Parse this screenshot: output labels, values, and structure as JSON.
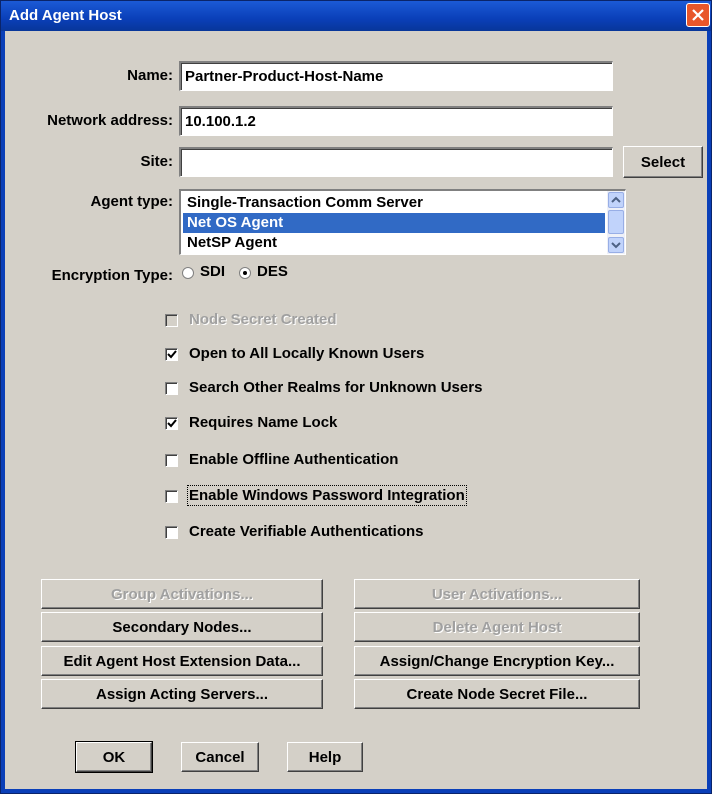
{
  "window": {
    "title": "Add Agent Host"
  },
  "fields": {
    "name_label": "Name:",
    "name_value": "Partner-Product-Host-Name",
    "address_label": "Network address:",
    "address_value": "10.100.1.2",
    "site_label": "Site:",
    "site_value": "",
    "select_button": "Select",
    "agent_type_label": "Agent type:"
  },
  "agent_types": [
    {
      "label": "Single-Transaction Comm Server",
      "selected": false
    },
    {
      "label": "Net OS Agent",
      "selected": true
    },
    {
      "label": "NetSP Agent",
      "selected": false
    }
  ],
  "encryption": {
    "label": "Encryption Type:",
    "options": [
      {
        "label": "SDI",
        "checked": false
      },
      {
        "label": "DES",
        "checked": true
      }
    ]
  },
  "checkboxes": [
    {
      "label": "Node Secret Created",
      "checked": false,
      "disabled": true
    },
    {
      "label": "Open to All Locally Known Users",
      "checked": true,
      "disabled": false
    },
    {
      "label": "Search Other Realms for Unknown Users",
      "checked": false,
      "disabled": false
    },
    {
      "label": "Requires Name Lock",
      "checked": true,
      "disabled": false
    },
    {
      "label": "Enable Offline Authentication",
      "checked": false,
      "disabled": false
    },
    {
      "label": "Enable Windows Password Integration",
      "checked": false,
      "disabled": false
    },
    {
      "label": "Create Verifiable Authentications",
      "checked": false,
      "disabled": false
    }
  ],
  "action_buttons": {
    "group_activations": "Group Activations...",
    "user_activations": "User Activations...",
    "secondary_nodes": "Secondary Nodes...",
    "delete_agent_host": "Delete Agent Host",
    "edit_extension_data": "Edit Agent Host Extension Data...",
    "assign_encryption_key": "Assign/Change Encryption Key...",
    "assign_acting_servers": "Assign Acting Servers...",
    "create_node_secret": "Create Node Secret File..."
  },
  "footer_buttons": {
    "ok": "OK",
    "cancel": "Cancel",
    "help": "Help"
  },
  "colors": {
    "title_bar": "#0a3fb8",
    "selection": "#316ac5",
    "dialog_bg": "#d4d0c8",
    "close_button": "#e8562a"
  }
}
